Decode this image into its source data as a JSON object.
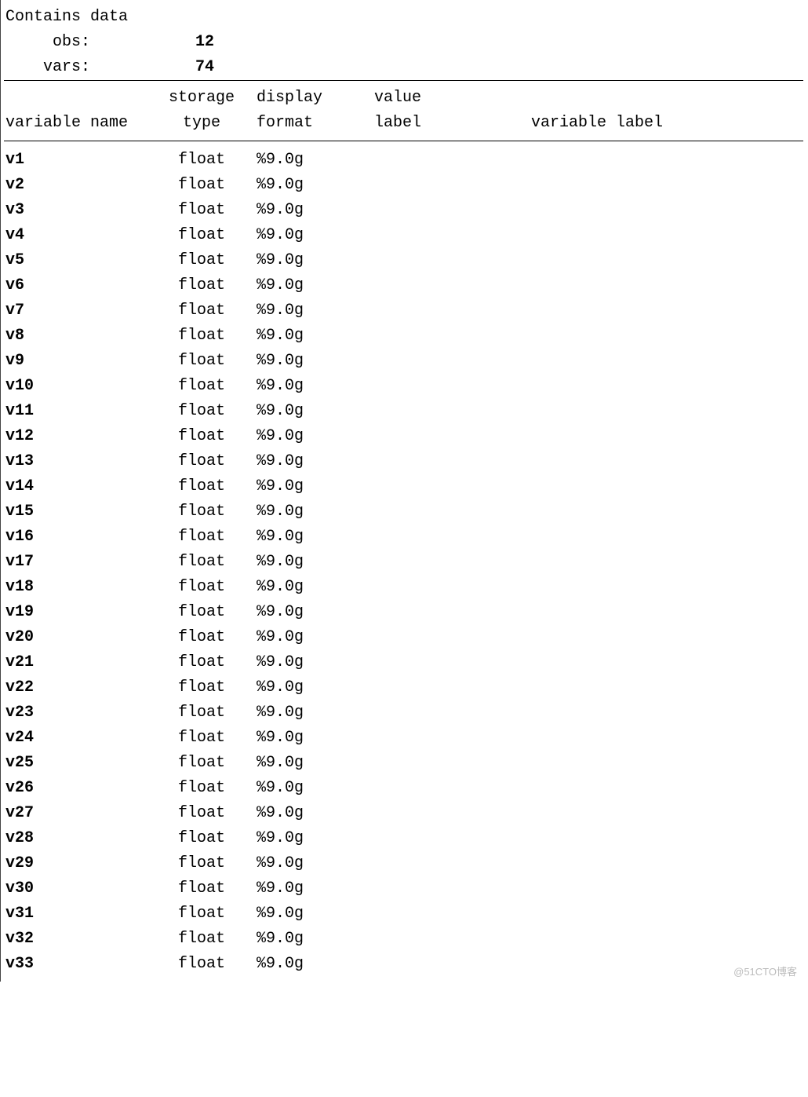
{
  "header": {
    "contains": "Contains data",
    "obs_label": "obs:",
    "obs_value": "12",
    "vars_label": "vars:",
    "vars_value": "74"
  },
  "columns": {
    "name_l1": "",
    "name_l2": "variable name",
    "type_l1": "storage",
    "type_l2": "type",
    "fmt_l1": "display",
    "fmt_l2": "format",
    "vlab_l1": "value",
    "vlab_l2": "label",
    "lab_l1": "",
    "lab_l2": "variable label"
  },
  "rows": [
    {
      "name": "v1",
      "type": "float",
      "fmt": "%9.0g",
      "vlab": "",
      "lab": ""
    },
    {
      "name": "v2",
      "type": "float",
      "fmt": "%9.0g",
      "vlab": "",
      "lab": ""
    },
    {
      "name": "v3",
      "type": "float",
      "fmt": "%9.0g",
      "vlab": "",
      "lab": ""
    },
    {
      "name": "v4",
      "type": "float",
      "fmt": "%9.0g",
      "vlab": "",
      "lab": ""
    },
    {
      "name": "v5",
      "type": "float",
      "fmt": "%9.0g",
      "vlab": "",
      "lab": ""
    },
    {
      "name": "v6",
      "type": "float",
      "fmt": "%9.0g",
      "vlab": "",
      "lab": ""
    },
    {
      "name": "v7",
      "type": "float",
      "fmt": "%9.0g",
      "vlab": "",
      "lab": ""
    },
    {
      "name": "v8",
      "type": "float",
      "fmt": "%9.0g",
      "vlab": "",
      "lab": ""
    },
    {
      "name": "v9",
      "type": "float",
      "fmt": "%9.0g",
      "vlab": "",
      "lab": ""
    },
    {
      "name": "v10",
      "type": "float",
      "fmt": "%9.0g",
      "vlab": "",
      "lab": ""
    },
    {
      "name": "v11",
      "type": "float",
      "fmt": "%9.0g",
      "vlab": "",
      "lab": ""
    },
    {
      "name": "v12",
      "type": "float",
      "fmt": "%9.0g",
      "vlab": "",
      "lab": ""
    },
    {
      "name": "v13",
      "type": "float",
      "fmt": "%9.0g",
      "vlab": "",
      "lab": ""
    },
    {
      "name": "v14",
      "type": "float",
      "fmt": "%9.0g",
      "vlab": "",
      "lab": ""
    },
    {
      "name": "v15",
      "type": "float",
      "fmt": "%9.0g",
      "vlab": "",
      "lab": ""
    },
    {
      "name": "v16",
      "type": "float",
      "fmt": "%9.0g",
      "vlab": "",
      "lab": ""
    },
    {
      "name": "v17",
      "type": "float",
      "fmt": "%9.0g",
      "vlab": "",
      "lab": ""
    },
    {
      "name": "v18",
      "type": "float",
      "fmt": "%9.0g",
      "vlab": "",
      "lab": ""
    },
    {
      "name": "v19",
      "type": "float",
      "fmt": "%9.0g",
      "vlab": "",
      "lab": ""
    },
    {
      "name": "v20",
      "type": "float",
      "fmt": "%9.0g",
      "vlab": "",
      "lab": ""
    },
    {
      "name": "v21",
      "type": "float",
      "fmt": "%9.0g",
      "vlab": "",
      "lab": ""
    },
    {
      "name": "v22",
      "type": "float",
      "fmt": "%9.0g",
      "vlab": "",
      "lab": ""
    },
    {
      "name": "v23",
      "type": "float",
      "fmt": "%9.0g",
      "vlab": "",
      "lab": ""
    },
    {
      "name": "v24",
      "type": "float",
      "fmt": "%9.0g",
      "vlab": "",
      "lab": ""
    },
    {
      "name": "v25",
      "type": "float",
      "fmt": "%9.0g",
      "vlab": "",
      "lab": ""
    },
    {
      "name": "v26",
      "type": "float",
      "fmt": "%9.0g",
      "vlab": "",
      "lab": ""
    },
    {
      "name": "v27",
      "type": "float",
      "fmt": "%9.0g",
      "vlab": "",
      "lab": ""
    },
    {
      "name": "v28",
      "type": "float",
      "fmt": "%9.0g",
      "vlab": "",
      "lab": ""
    },
    {
      "name": "v29",
      "type": "float",
      "fmt": "%9.0g",
      "vlab": "",
      "lab": ""
    },
    {
      "name": "v30",
      "type": "float",
      "fmt": "%9.0g",
      "vlab": "",
      "lab": ""
    },
    {
      "name": "v31",
      "type": "float",
      "fmt": "%9.0g",
      "vlab": "",
      "lab": ""
    },
    {
      "name": "v32",
      "type": "float",
      "fmt": "%9.0g",
      "vlab": "",
      "lab": ""
    },
    {
      "name": "v33",
      "type": "float",
      "fmt": "%9.0g",
      "vlab": "",
      "lab": ""
    }
  ],
  "watermark": "@51CTO博客"
}
